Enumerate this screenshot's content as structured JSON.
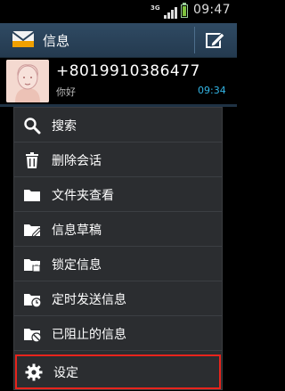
{
  "status_bar": {
    "network": "3G",
    "time": "09:47"
  },
  "action_bar": {
    "title": "信息",
    "app_icon": "envelope-icon",
    "compose_icon": "compose-icon"
  },
  "conversation": {
    "name": "+8019910386477",
    "snippet": "你好",
    "time": "09:34",
    "time_color": "#33b5e5"
  },
  "menu": {
    "items": [
      {
        "label": "搜索",
        "icon": "search-icon"
      },
      {
        "label": "删除会话",
        "icon": "trash-icon"
      },
      {
        "label": "文件夹查看",
        "icon": "folder-icon"
      },
      {
        "label": "信息草稿",
        "icon": "draft-folder-icon"
      },
      {
        "label": "锁定信息",
        "icon": "locked-folder-icon"
      },
      {
        "label": "定时发送信息",
        "icon": "scheduled-folder-icon"
      },
      {
        "label": "已阻止的信息",
        "icon": "blocked-folder-icon"
      },
      {
        "label": "设定",
        "icon": "gear-icon"
      }
    ],
    "highlight_color": "#e8241c"
  }
}
